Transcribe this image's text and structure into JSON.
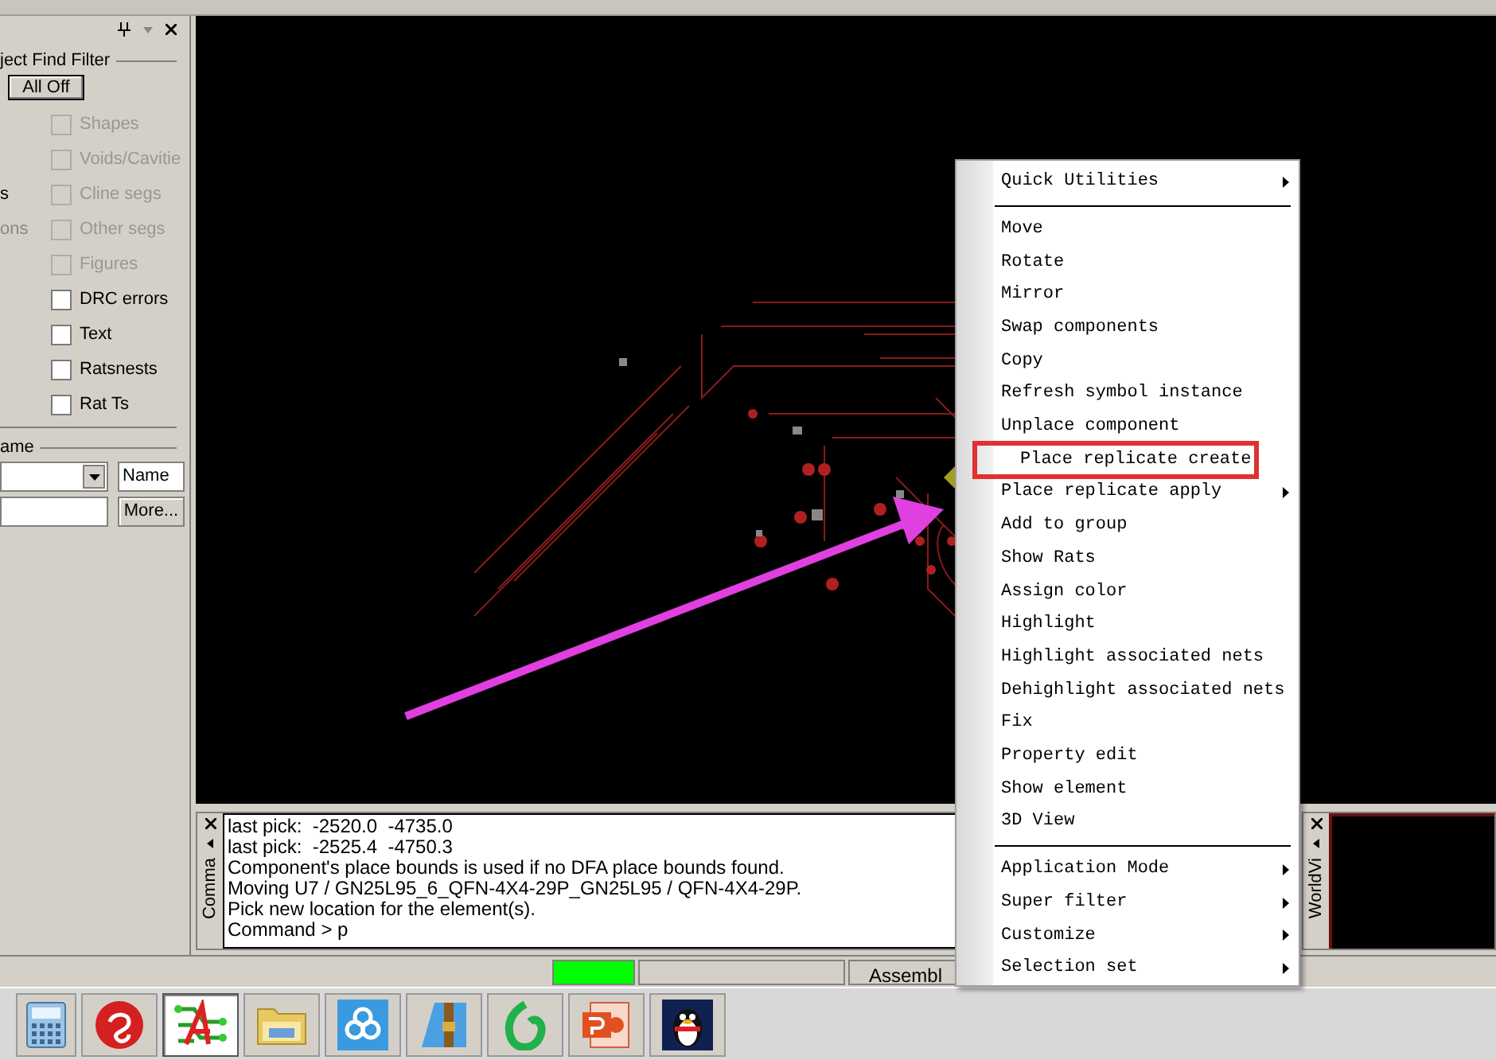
{
  "find_panel": {
    "group_label": "ject Find Filter",
    "all_off_button": "All Off",
    "rows": [
      {
        "label": "Shapes",
        "checked": false,
        "disabled": true
      },
      {
        "label": "Voids/Cavitie",
        "checked": false,
        "disabled": true
      },
      {
        "label": "Cline segs",
        "checked": false,
        "disabled": true,
        "side_text": "s",
        "side_disabled": false
      },
      {
        "label": "Other segs",
        "checked": false,
        "disabled": true,
        "side_text": "ons",
        "side_disabled": true
      },
      {
        "label": "Figures",
        "checked": false,
        "disabled": true
      },
      {
        "label": "DRC errors",
        "checked": false,
        "disabled": false
      },
      {
        "label": "Text",
        "checked": false,
        "disabled": false
      },
      {
        "label": "Ratsnests",
        "checked": false,
        "disabled": false
      },
      {
        "label": "Rat Ts",
        "checked": false,
        "disabled": false
      }
    ],
    "name_group_label": "ame",
    "sort_dropdown": "Name",
    "more_button": "More..."
  },
  "command_panel": {
    "tab_label": "Comma",
    "lines": [
      "last pick:  -2520.0  -4735.0",
      "last pick:  -2525.4  -4750.3",
      "Component's place bounds is used if no DFA place bounds found.",
      "Moving U7 / GN25L95_6_QFN-4X4-29P_GN25L95 / QFN-4X4-29P.",
      "Pick new location for the element(s).",
      "Command > p"
    ]
  },
  "worldview_panel": {
    "tab_label": "WorldVi"
  },
  "context_menu": {
    "items": [
      {
        "kind": "item",
        "label": "Quick Utilities",
        "submenu": true,
        "annotated": false
      },
      {
        "kind": "separator"
      },
      {
        "kind": "item",
        "label": "Move",
        "submenu": false,
        "annotated": false
      },
      {
        "kind": "item",
        "label": "Rotate",
        "submenu": false,
        "annotated": false
      },
      {
        "kind": "item",
        "label": "Mirror",
        "submenu": false,
        "annotated": false
      },
      {
        "kind": "item",
        "label": "Swap components",
        "submenu": false,
        "annotated": false
      },
      {
        "kind": "item",
        "label": "Copy",
        "submenu": false,
        "annotated": false
      },
      {
        "kind": "item",
        "label": "Refresh symbol instance",
        "submenu": false,
        "annotated": false
      },
      {
        "kind": "item",
        "label": "Unplace component",
        "submenu": false,
        "annotated": false
      },
      {
        "kind": "item",
        "label": "Place replicate create",
        "submenu": false,
        "annotated": true
      },
      {
        "kind": "item",
        "label": "Place replicate apply",
        "submenu": true,
        "annotated": false
      },
      {
        "kind": "item",
        "label": "Add to group",
        "submenu": false,
        "annotated": false
      },
      {
        "kind": "item",
        "label": "Show Rats",
        "submenu": false,
        "annotated": false
      },
      {
        "kind": "item",
        "label": "Assign color",
        "submenu": false,
        "annotated": false
      },
      {
        "kind": "item",
        "label": "Highlight",
        "submenu": false,
        "annotated": false
      },
      {
        "kind": "item",
        "label": "Highlight associated nets",
        "submenu": false,
        "annotated": false
      },
      {
        "kind": "item",
        "label": "Dehighlight associated nets",
        "submenu": false,
        "annotated": false
      },
      {
        "kind": "item",
        "label": "Fix",
        "submenu": false,
        "annotated": false
      },
      {
        "kind": "item",
        "label": "Property edit",
        "submenu": false,
        "annotated": false
      },
      {
        "kind": "item",
        "label": "Show element",
        "submenu": false,
        "annotated": false
      },
      {
        "kind": "item",
        "label": "3D View",
        "submenu": false,
        "annotated": false
      },
      {
        "kind": "separator"
      },
      {
        "kind": "item",
        "label": "Application Mode",
        "submenu": true,
        "annotated": false
      },
      {
        "kind": "item",
        "label": "Super filter",
        "submenu": true,
        "annotated": false
      },
      {
        "kind": "item",
        "label": "Customize",
        "submenu": true,
        "annotated": false
      },
      {
        "kind": "item",
        "label": "Selection set",
        "submenu": true,
        "annotated": false
      }
    ]
  },
  "status_bar": {
    "cells": [
      {
        "kind": "blank"
      },
      {
        "kind": "indicator",
        "color": "#00ff00"
      },
      {
        "kind": "blank"
      },
      {
        "kind": "text",
        "text": "Assembl"
      }
    ]
  },
  "taskbar": {
    "apps": [
      {
        "kind": "calculator",
        "selected": false
      },
      {
        "kind": "red-circle",
        "selected": false
      },
      {
        "kind": "pcb",
        "selected": true
      },
      {
        "kind": "folder",
        "selected": false
      },
      {
        "kind": "cloud",
        "selected": false
      },
      {
        "kind": "archive",
        "selected": false
      },
      {
        "kind": "green-loop",
        "selected": false
      },
      {
        "kind": "slides",
        "selected": false
      },
      {
        "kind": "penguin",
        "selected": false
      }
    ]
  }
}
